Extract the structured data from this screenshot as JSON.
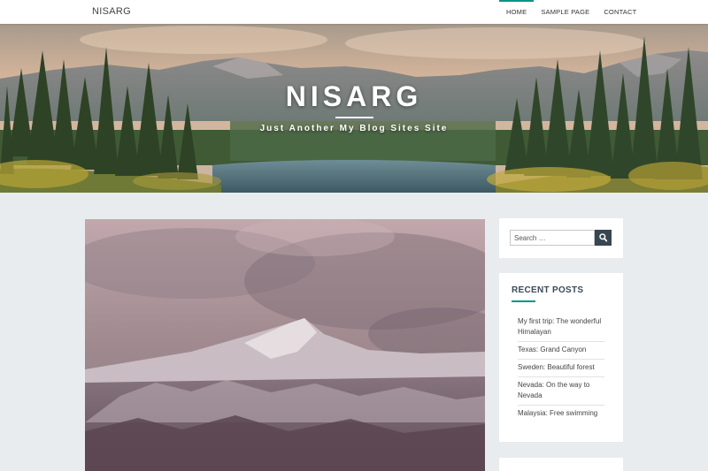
{
  "site": {
    "brand": "NISARG",
    "title": "NISARG",
    "tagline": "Just Another My Blog Sites Site"
  },
  "nav": {
    "items": [
      {
        "label": "HOME",
        "active": true
      },
      {
        "label": "SAMPLE PAGE",
        "active": false
      },
      {
        "label": "CONTACT",
        "active": false
      }
    ]
  },
  "search": {
    "placeholder": "Search …",
    "button_icon": "search-icon"
  },
  "recent_posts": {
    "title": "RECENT POSTS",
    "items": [
      {
        "label": "My first trip: The wonderful Himalayan"
      },
      {
        "label": "Texas: Grand Canyon"
      },
      {
        "label": "Sweden: Beautiful forest"
      },
      {
        "label": "Nevada: On the way to Nevada"
      },
      {
        "label": "Malaysia: Free swimming"
      }
    ]
  },
  "colors": {
    "accent": "#009688",
    "page_background": "#e9ecef",
    "search_button": "#37474f"
  }
}
